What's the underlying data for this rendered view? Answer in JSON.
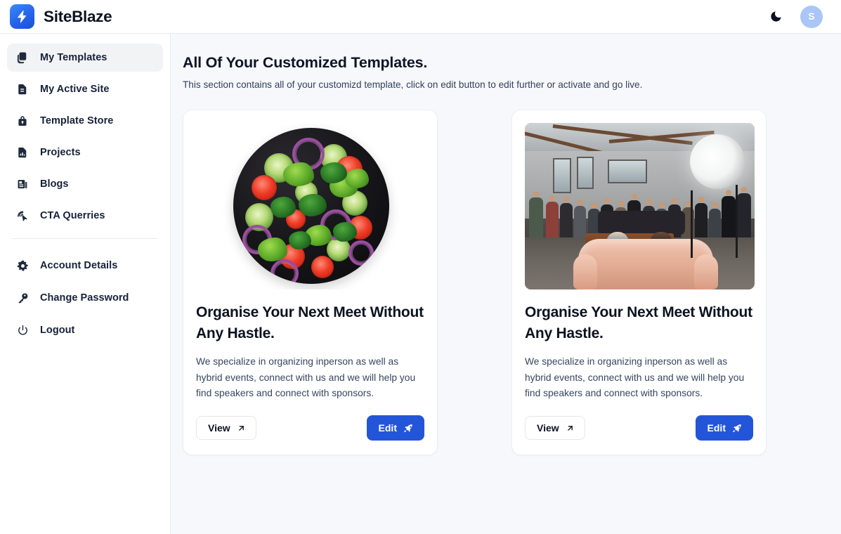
{
  "app": {
    "brand_name": "SiteBlaze",
    "logo_icon": "lightning-bolt-icon",
    "accent_color": "#2355d9",
    "logo_gradient_from": "#3b8cfa",
    "logo_gradient_to": "#1d4ed8"
  },
  "topbar": {
    "theme_toggle_icon": "moon-icon",
    "avatar_initial": "S",
    "avatar_color": "#a9c6f7"
  },
  "sidebar": {
    "primary_items": [
      {
        "label": "My Templates",
        "icon": "templates-copy-icon",
        "active": true
      },
      {
        "label": "My Active Site",
        "icon": "document-icon",
        "active": false
      },
      {
        "label": "Template Store",
        "icon": "lock-bag-icon",
        "active": false
      },
      {
        "label": "Projects",
        "icon": "chart-document-icon",
        "active": false
      },
      {
        "label": "Blogs",
        "icon": "newspaper-icon",
        "active": false
      },
      {
        "label": "CTA Querries",
        "icon": "cursor-click-icon",
        "active": false
      }
    ],
    "secondary_items": [
      {
        "label": "Account Details",
        "icon": "gear-icon"
      },
      {
        "label": "Change Password",
        "icon": "key-icon"
      },
      {
        "label": "Logout",
        "icon": "power-icon"
      }
    ]
  },
  "main": {
    "title": "All Of Your Customized Templates.",
    "subtitle": "This section contains all of your customizd template, click on edit button to edit further or activate and go live.",
    "cards": [
      {
        "image_alt": "fresh-salad-bowl-photo",
        "image_kind": "salad",
        "title": "Organise Your Next Meet Without Any Hastle.",
        "description": "We specialize in organizing inperson as well as hybrid events, connect with us and we will help you find speakers and connect with sponsors.",
        "view_label": "View",
        "view_icon": "arrow-up-right-icon",
        "edit_label": "Edit",
        "edit_icon": "rocket-icon"
      },
      {
        "image_alt": "event-studio-crowd-photo",
        "image_kind": "event",
        "title": "Organise Your Next Meet Without Any Hastle.",
        "description": "We specialize in organizing inperson as well as hybrid events, connect with us and we will help you find speakers and connect with sponsors.",
        "view_label": "View",
        "view_icon": "arrow-up-right-icon",
        "edit_label": "Edit",
        "edit_icon": "rocket-icon"
      }
    ]
  }
}
